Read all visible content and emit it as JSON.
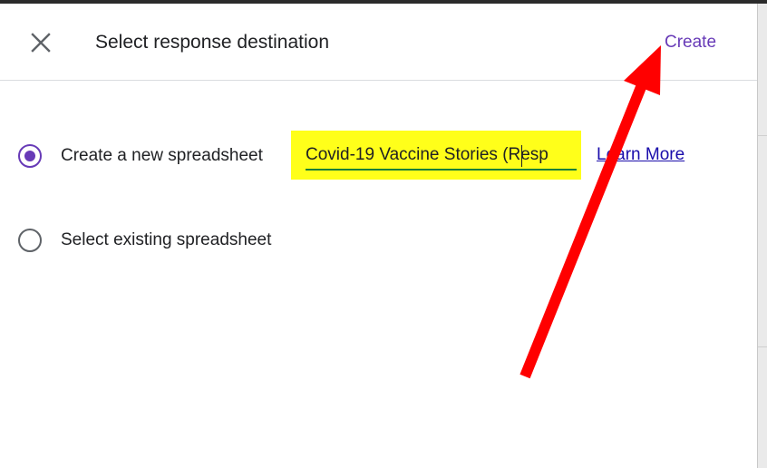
{
  "dialog": {
    "title": "Select response destination",
    "create_label": "Create",
    "close_icon": "close-icon"
  },
  "options": [
    {
      "label": "Create a new spreadsheet",
      "selected": true,
      "spreadsheet_name": "Covid-19 Vaccine Stories (Resp",
      "link_label": "Learn More"
    },
    {
      "label": "Select existing spreadsheet",
      "selected": false
    }
  ],
  "annotation": {
    "arrow_icon": "red-arrow-icon",
    "arrow_color": "#ff0000",
    "highlight_color": "#ffff1a"
  },
  "colors": {
    "accent": "#673ab7",
    "link": "#1a0dab",
    "field_underline": "#188038",
    "text": "#202124"
  }
}
